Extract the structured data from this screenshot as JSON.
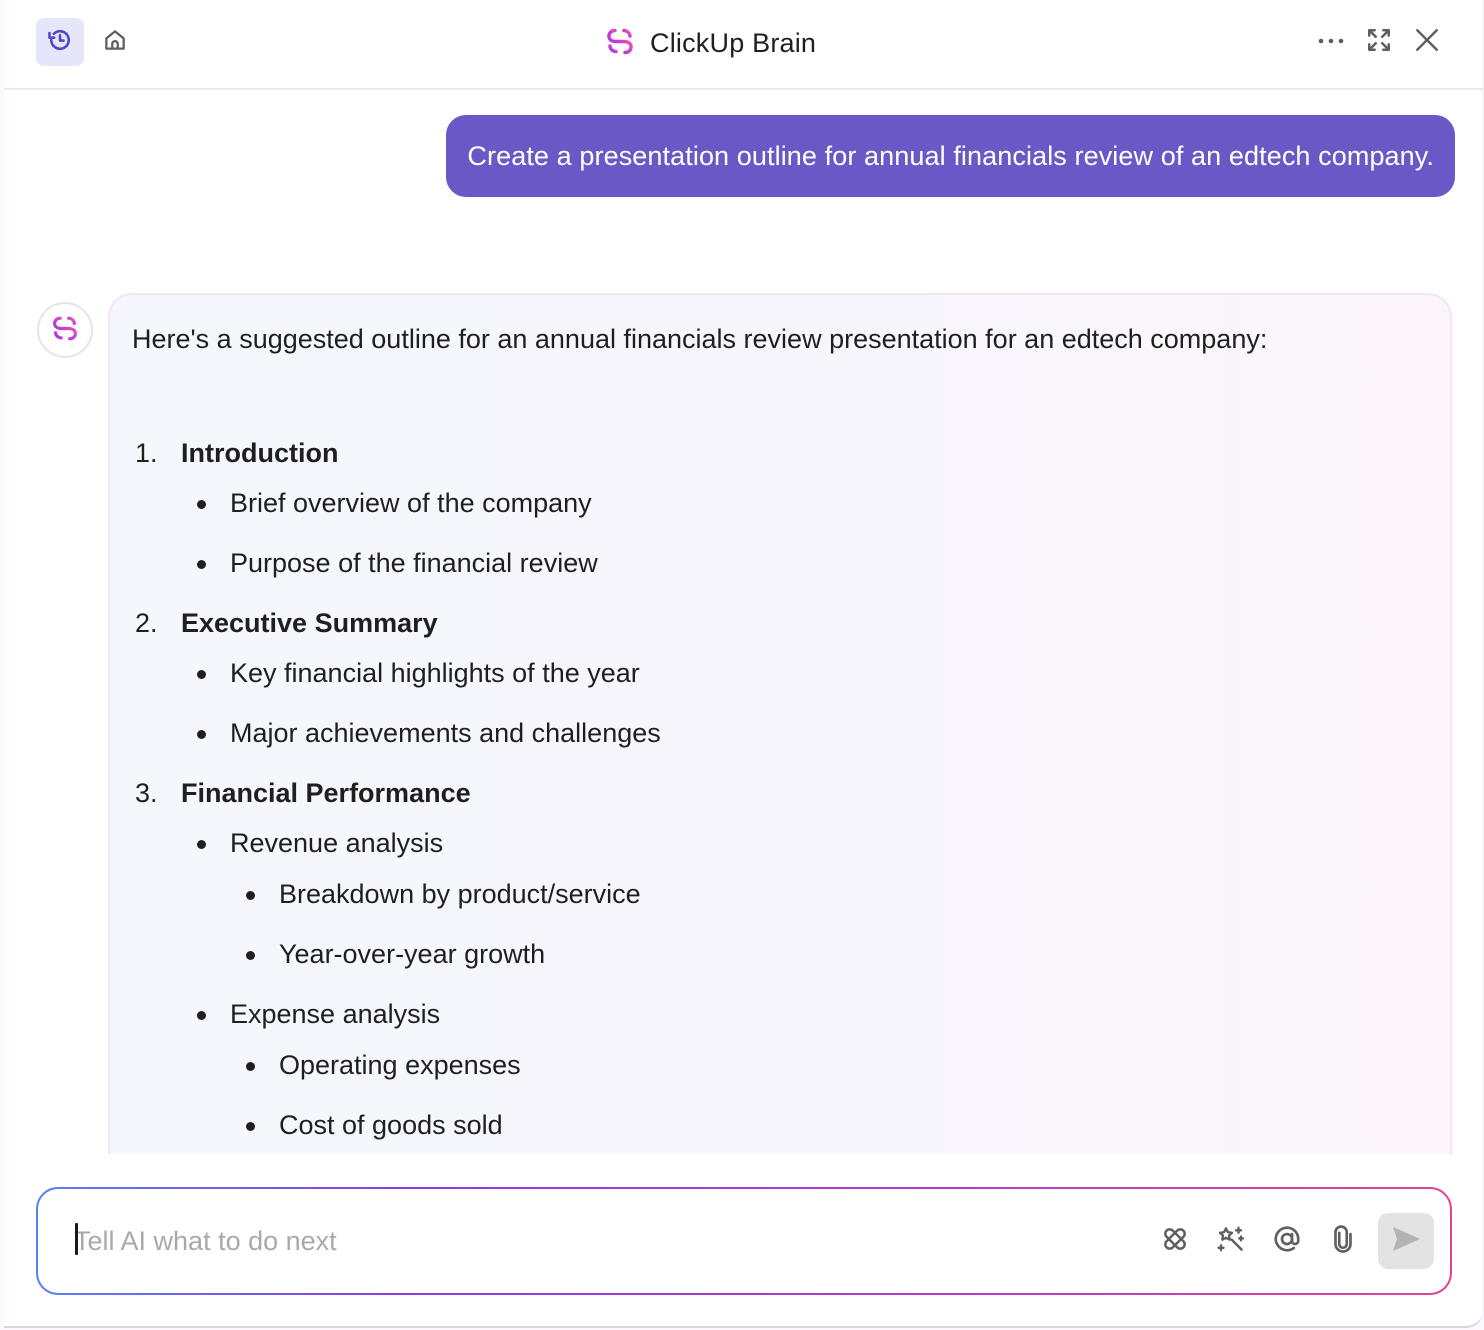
{
  "header": {
    "title": "ClickUp Brain",
    "icons": {
      "history": "history-icon",
      "home": "home-icon",
      "logo": "clickup-brain-logo-icon",
      "more": "more-horizontal-icon",
      "expand": "expand-icon",
      "close": "close-icon"
    }
  },
  "conversation": {
    "user_message": "Create a presentation outline for annual financials review of an edtech company.",
    "ai_response": {
      "intro": "Here's a suggested outline for an annual financials review presentation for an edtech company:",
      "sections": [
        {
          "number": "1.",
          "title": "Introduction",
          "items": [
            {
              "text": "Brief overview of the company",
              "children": []
            },
            {
              "text": "Purpose of the financial review",
              "children": []
            }
          ]
        },
        {
          "number": "2.",
          "title": "Executive Summary",
          "items": [
            {
              "text": "Key financial highlights of the year",
              "children": []
            },
            {
              "text": "Major achievements and challenges",
              "children": []
            }
          ]
        },
        {
          "number": "3.",
          "title": "Financial Performance",
          "items": [
            {
              "text": "Revenue analysis",
              "children": [
                "Breakdown by product/service",
                "Year-over-year growth"
              ]
            },
            {
              "text": "Expense analysis",
              "children": [
                "Operating expenses",
                "Cost of goods sold"
              ]
            }
          ]
        }
      ]
    }
  },
  "composer": {
    "placeholder": "Tell AI what to do next",
    "value": "",
    "tools": [
      "integrations-icon",
      "magic-wand-icon",
      "mention-icon",
      "attachment-icon"
    ],
    "send_icon": "send-icon"
  },
  "colors": {
    "accent": "#6b58c7",
    "history_active_bg": "#e6e6fb",
    "send_disabled_bg": "#e3e3e3"
  }
}
